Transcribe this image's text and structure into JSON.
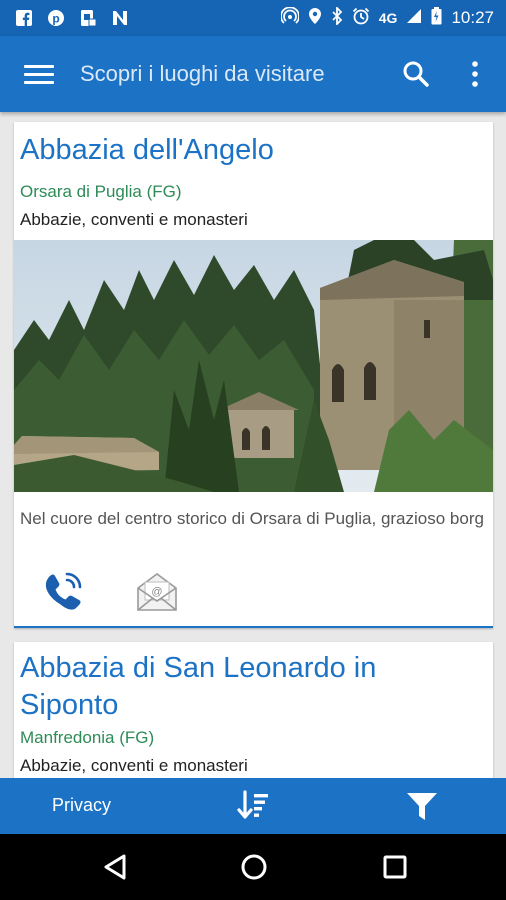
{
  "status_bar": {
    "time": "10:27",
    "network": "4G",
    "left_icons": [
      "facebook-icon",
      "pinterest-icon",
      "sim-icon",
      "n-app-icon"
    ],
    "right_icons": [
      "hotspot-icon",
      "location-icon",
      "bluetooth-icon",
      "alarm-icon",
      "signal-icon",
      "battery-icon"
    ]
  },
  "app_bar": {
    "title": "Scopri i luoghi da visitare"
  },
  "places": [
    {
      "title": "Abbazia dell'Angelo",
      "location": "Orsara di Puglia (FG)",
      "category": "Abbazie, conventi e monasteri",
      "description": "Nel cuore del centro storico di Orsara di Puglia, grazioso borg"
    },
    {
      "title": "Abbazia di San Leonardo in Siponto",
      "location": "Manfredonia (FG)",
      "category": "Abbazie, conventi e monasteri"
    }
  ],
  "bottom_bar": {
    "privacy_label": "Privacy"
  },
  "colors": {
    "primary": "#1c72c5",
    "status_bar": "#1565b4",
    "location_text": "#2e8b57"
  }
}
